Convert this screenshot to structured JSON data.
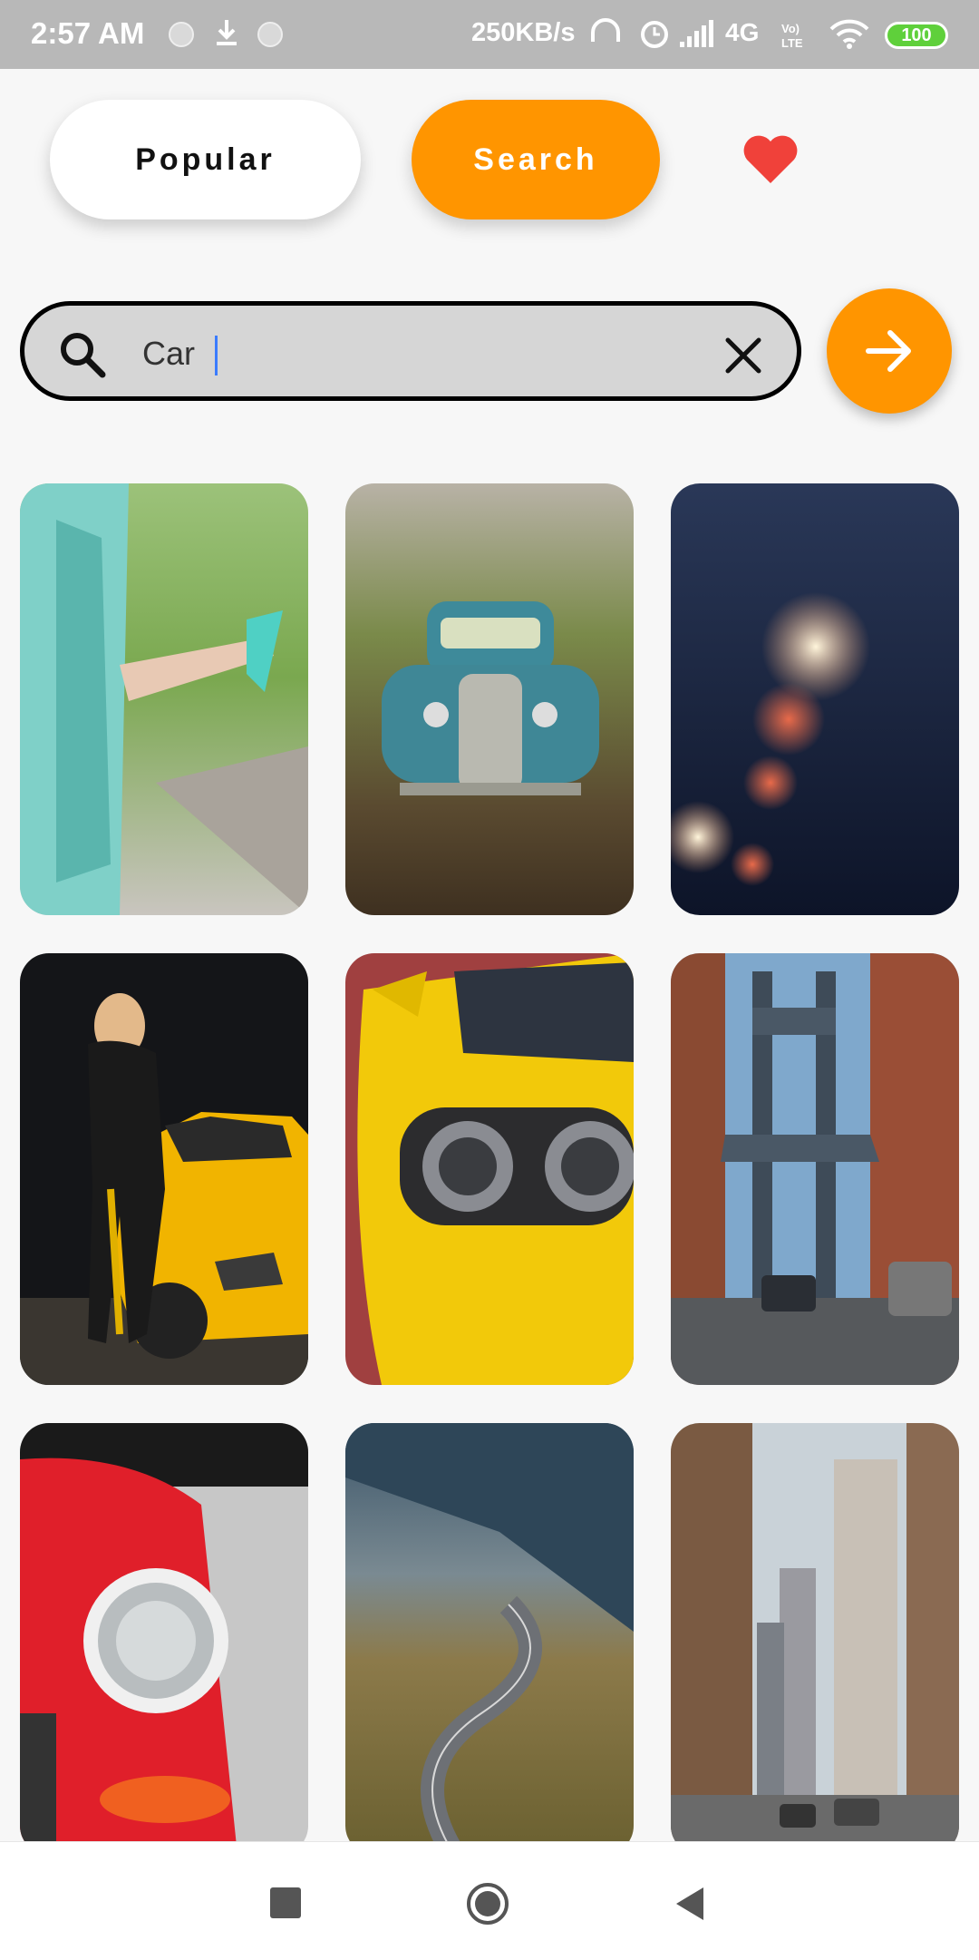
{
  "status_bar": {
    "time": "2:57 AM",
    "network_speed": "250KB/s",
    "network_type": "4G",
    "battery": "100",
    "icons": [
      "notification-dot-icon",
      "download-icon",
      "notification-dot-icon",
      "headphones-icon",
      "alarm-icon",
      "signal-icon",
      "volte-icon",
      "wifi-icon",
      "battery-icon"
    ]
  },
  "tabs": [
    {
      "label": "Popular",
      "selected": false
    },
    {
      "label": "Search",
      "selected": true
    }
  ],
  "favorites_icon": "heart-icon",
  "search": {
    "value": "Car",
    "placeholder": "",
    "search_icon": "search-icon",
    "clear_icon": "close-icon",
    "submit_icon": "arrow-right-icon"
  },
  "grid": {
    "images": [
      "car-door-legs-photo",
      "vintage-blue-truck-photo",
      "rain-bokeh-lights-photo",
      "woman-yellow-sports-car-photo",
      "yellow-car-headlights-photo",
      "manhattan-bridge-street-photo",
      "red-classic-car-headlight-photo",
      "winding-mountain-road-photo",
      "city-skyscrapers-street-photo"
    ]
  },
  "nav_bar": {
    "icons": [
      "recent-apps-icon",
      "home-icon",
      "back-icon"
    ]
  },
  "colors": {
    "accent": "#ff9500",
    "heart": "#f0413a",
    "background": "#f7f7f7",
    "status_bar": "#b8b8b8"
  }
}
